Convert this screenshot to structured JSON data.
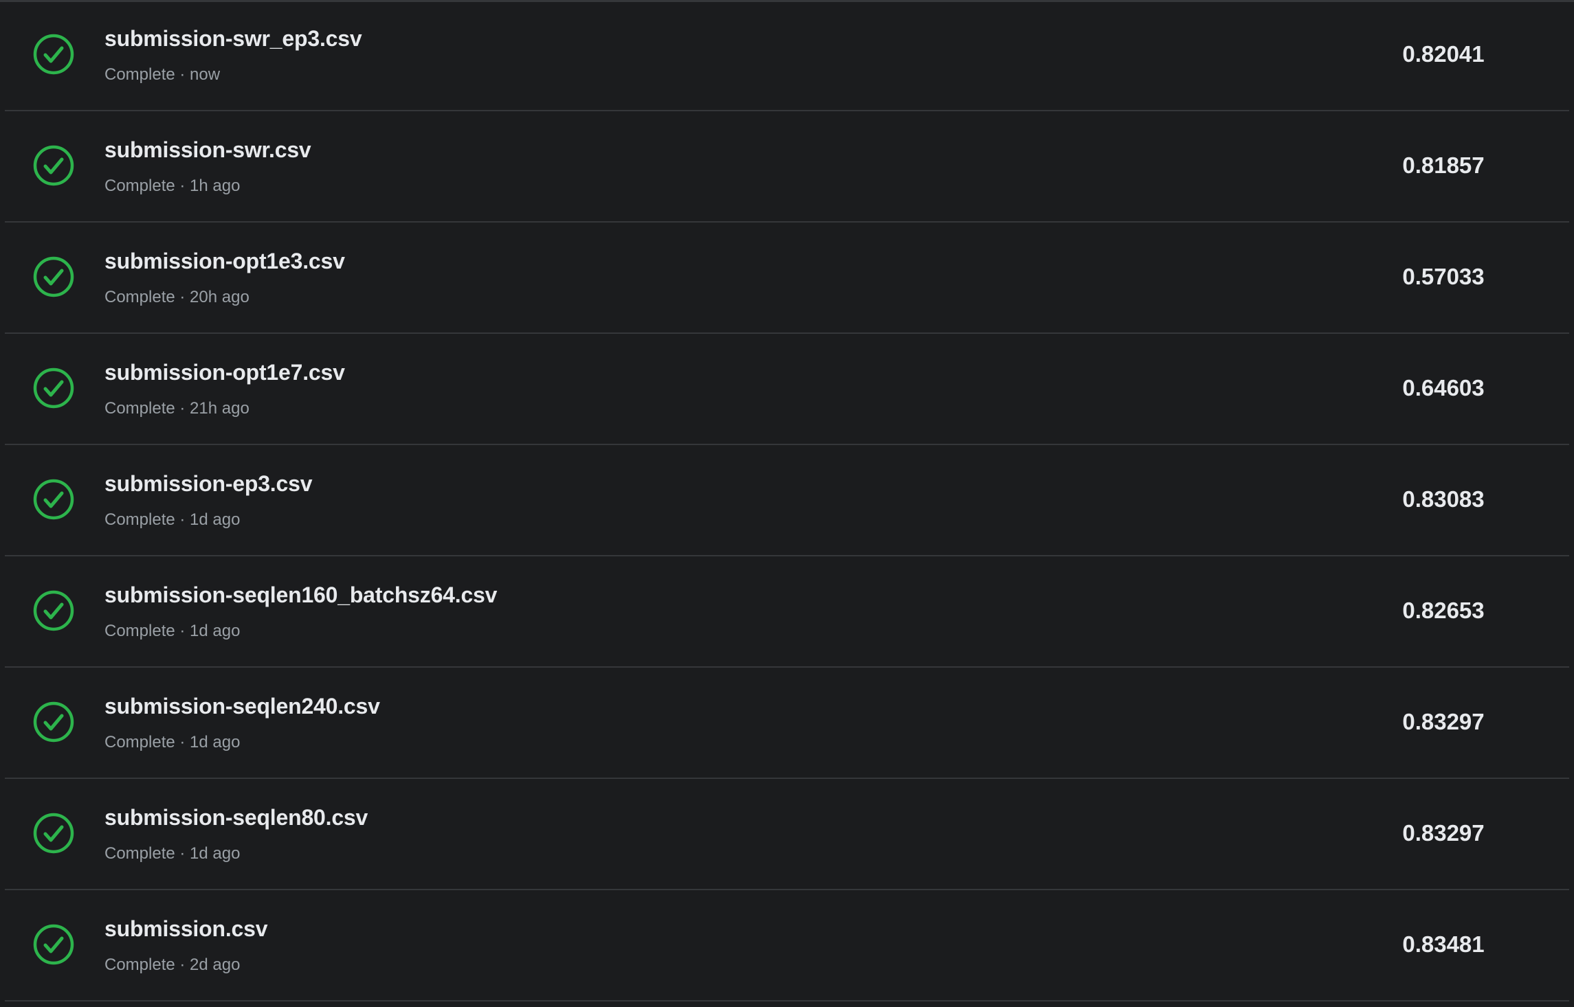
{
  "colors": {
    "background": "#1b1c1e",
    "success": "#2db44c",
    "divider": "#35373a"
  },
  "submissions": [
    {
      "file": "submission-swr_ep3.csv",
      "status": "Complete · now",
      "score": "0.82041",
      "icon": "check-circle-icon"
    },
    {
      "file": "submission-swr.csv",
      "status": "Complete · 1h ago",
      "score": "0.81857",
      "icon": "check-circle-icon"
    },
    {
      "file": "submission-opt1e3.csv",
      "status": "Complete · 20h ago",
      "score": "0.57033",
      "icon": "check-circle-icon"
    },
    {
      "file": "submission-opt1e7.csv",
      "status": "Complete · 21h ago",
      "score": "0.64603",
      "icon": "check-circle-icon"
    },
    {
      "file": "submission-ep3.csv",
      "status": "Complete · 1d ago",
      "score": "0.83083",
      "icon": "check-circle-icon"
    },
    {
      "file": "submission-seqlen160_batchsz64.csv",
      "status": "Complete · 1d ago",
      "score": "0.82653",
      "icon": "check-circle-icon"
    },
    {
      "file": "submission-seqlen240.csv",
      "status": "Complete · 1d ago",
      "score": "0.83297",
      "icon": "check-circle-icon"
    },
    {
      "file": "submission-seqlen80.csv",
      "status": "Complete · 1d ago",
      "score": "0.83297",
      "icon": "check-circle-icon"
    },
    {
      "file": "submission.csv",
      "status": "Complete · 2d ago",
      "score": "0.83481",
      "icon": "check-circle-icon"
    }
  ]
}
